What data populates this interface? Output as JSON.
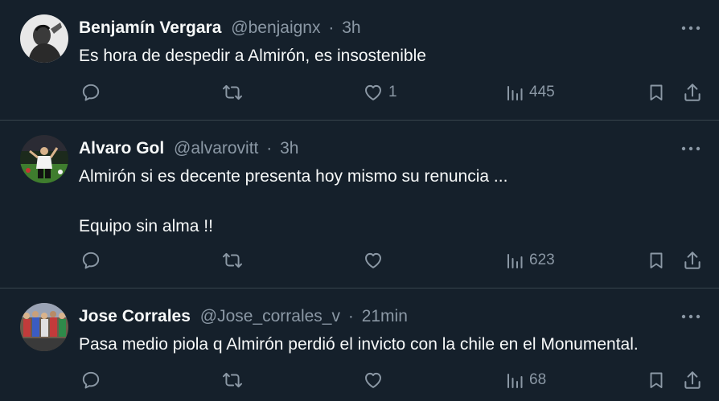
{
  "tweets": [
    {
      "name": "Benjamín Vergara",
      "handle": "@benjaignx",
      "dot": "·",
      "time": "3h",
      "text": [
        "Es hora de despedir a Almirón, es insostenible"
      ],
      "likes": "1",
      "views": "445"
    },
    {
      "name": "Alvaro Gol",
      "handle": "@alvarovitt",
      "dot": "·",
      "time": "3h",
      "text": [
        "Almirón si es decente presenta hoy mismo su renuncia ...",
        "Equipo sin alma !!"
      ],
      "likes": "",
      "views": "623"
    },
    {
      "name": "Jose Corrales",
      "handle": "@Jose_corrales_v",
      "dot": "·",
      "time": "21min",
      "text": [
        "Pasa medio piola q Almirón perdió el invicto con la chile en el Monumental."
      ],
      "likes": "",
      "views": "68"
    }
  ],
  "icons": {
    "reply": "speech-bubble-icon",
    "retweet": "retweet-arrows-icon",
    "like": "heart-icon",
    "views": "bar-chart-icon",
    "bookmark": "bookmark-icon",
    "share": "share-upload-icon",
    "more": "ellipsis-icon"
  },
  "colors": {
    "background": "#15202b",
    "primary_text": "#f7f9f9",
    "secondary_text": "#8b98a5",
    "divider": "#38444d"
  }
}
